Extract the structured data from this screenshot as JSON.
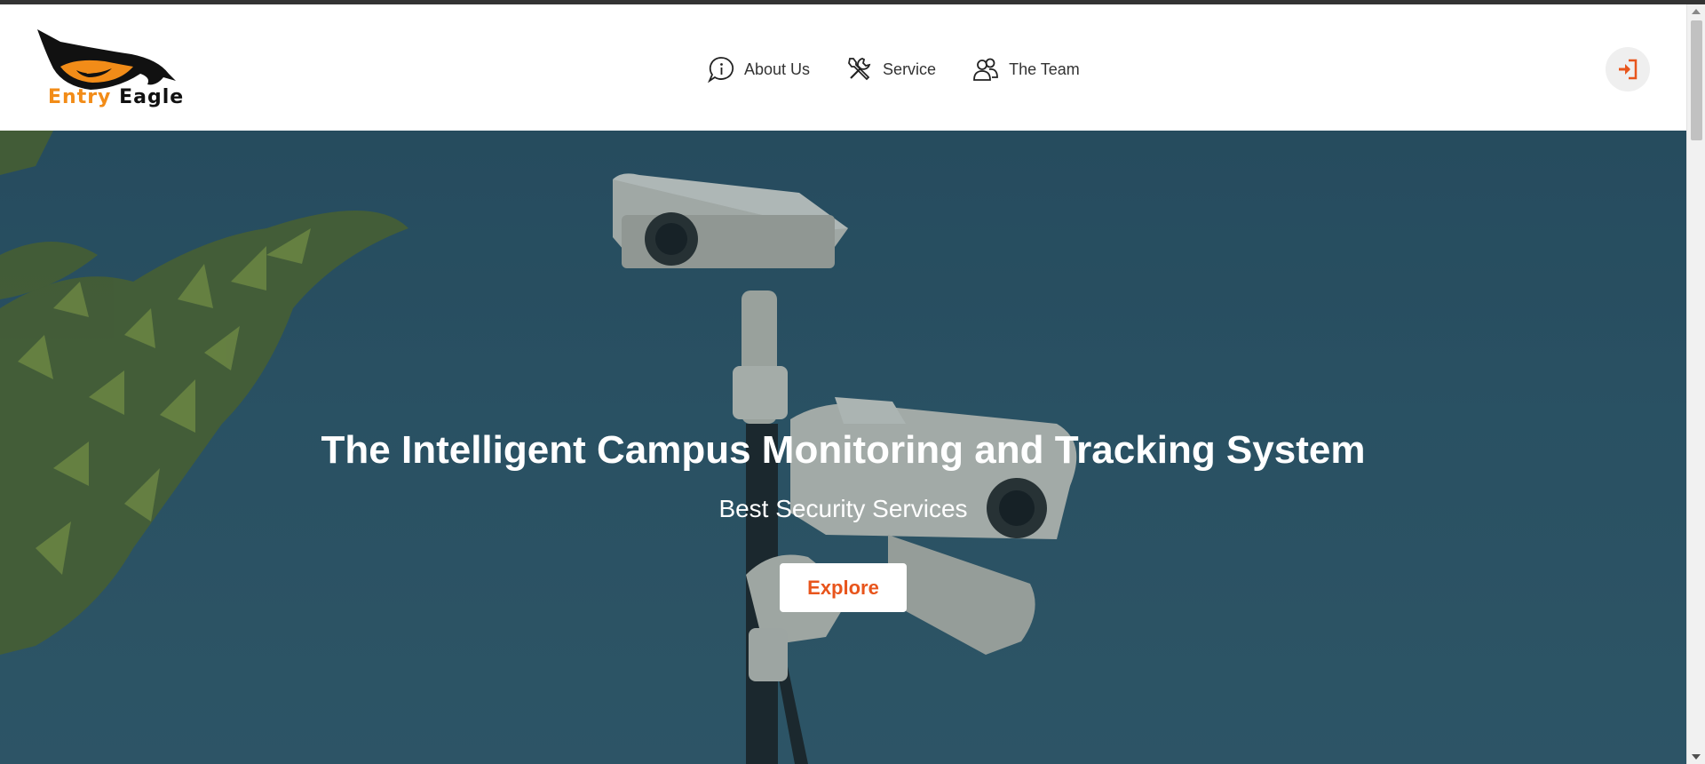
{
  "brand": {
    "logo_word1": "Entry",
    "logo_word2": "Eagle"
  },
  "nav": {
    "items": [
      {
        "label": "About Us",
        "icon": "info-bubble-icon"
      },
      {
        "label": "Service",
        "icon": "tools-icon"
      },
      {
        "label": "The Team",
        "icon": "team-icon"
      }
    ]
  },
  "header": {
    "login_icon": "login-icon"
  },
  "hero": {
    "title": "The Intelligent Campus Monitoring and Tracking System",
    "subtitle": "Best Security Services",
    "button_label": "Explore"
  },
  "colors": {
    "accent": "#e8551c",
    "logo_orange": "#f28c18",
    "hero_bg": "#2f5668"
  }
}
